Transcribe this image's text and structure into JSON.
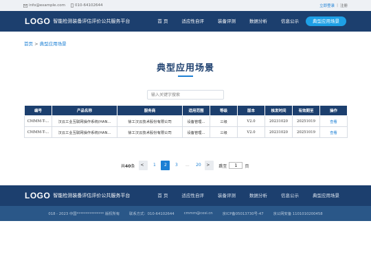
{
  "topbar": {
    "email": "info@example.com",
    "phone": "010-64102644",
    "login": "立即登录",
    "divider": "|",
    "register": "注册"
  },
  "header": {
    "logo": "LOGO",
    "site_title": "智能检测装备评估评价公共服务平台",
    "nav": [
      "首 页",
      "适应性自评",
      "装备评测",
      "数据分析",
      "信息公示",
      "典型应用场景"
    ]
  },
  "breadcrumb": {
    "home": "首页",
    "separator": " > ",
    "current": "典型应用场景"
  },
  "page_title": "典型应用场景",
  "search": {
    "placeholder": "输入关键字搜索"
  },
  "table": {
    "headers": [
      "编号",
      "产品名称",
      "服务商",
      "适用范围",
      "等级",
      "版本",
      "核发时间",
      "有效期至",
      "操作"
    ],
    "rows": [
      [
        "CMMM-T-...",
        "汉云工业互联网操作系统(HAN...",
        "徐工汉云技术股份有限公司",
        "设备管理...",
        "三级",
        "V2.0",
        "20231020",
        "20251019",
        "查看"
      ],
      [
        "CMMM-T-...",
        "汉云工业互联网操作系统(HAN...",
        "徐工汉云技术股份有限公司",
        "设备管理...",
        "三级",
        "V2.0",
        "20231020",
        "20251019",
        "查看"
      ]
    ]
  },
  "pagination": {
    "total_prefix": "共",
    "total": "40",
    "total_suffix": "条",
    "prev": "<",
    "pages": [
      "1",
      "2",
      "3",
      "...",
      "20"
    ],
    "current_page": "2",
    "next": ">",
    "goto_label": "跳至",
    "goto_value": "1",
    "goto_suffix": "页"
  },
  "footer": {
    "logo": "LOGO",
    "site_title": "智能检测装备评估评价公共服务平台",
    "nav": [
      "首 页",
      "适应性自评",
      "装备评测",
      "数据分析",
      "信息公示",
      "典型应用场景"
    ],
    "copyright": "018 - 2023 中国*************** 版权所有",
    "contact": "联系方式：010-64102644",
    "email": "cmmm@cesi.cn",
    "icp": "京ICP备05013730号-47",
    "police": "京公网安备 1101010200458"
  },
  "colors": {
    "header_bg": "#1c3f6e",
    "accent": "#1b7fd4",
    "active_nav": "#1ea0e6",
    "footer_info_bg": "#2a5788"
  }
}
